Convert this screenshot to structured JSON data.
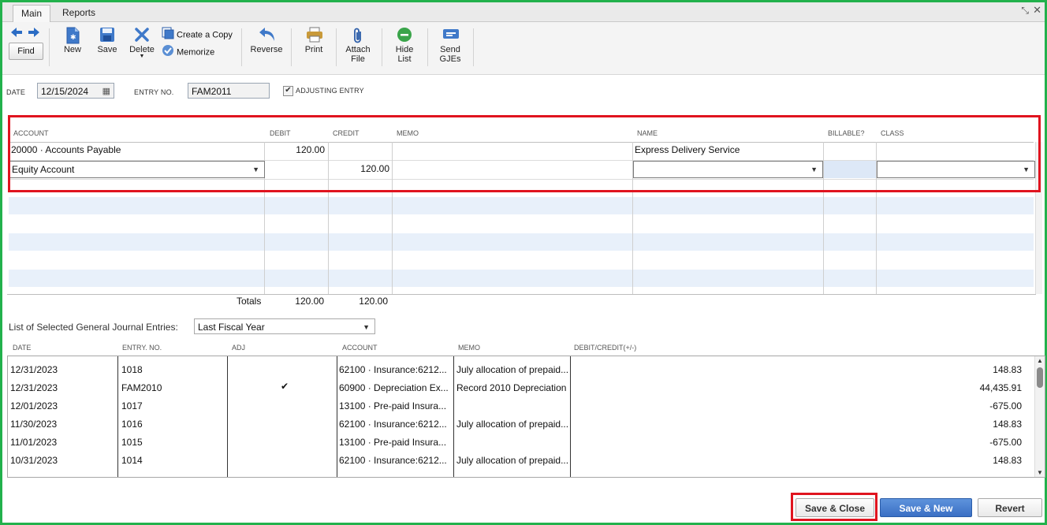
{
  "tabs": [
    {
      "label": "Main",
      "active": true
    },
    {
      "label": "Reports",
      "active": false
    }
  ],
  "toolbar": {
    "find": "Find",
    "new": "New",
    "save": "Save",
    "delete": "Delete",
    "create_copy": "Create a Copy",
    "memorize": "Memorize",
    "reverse": "Reverse",
    "print": "Print",
    "attach_line1": "Attach",
    "attach_line2": "File",
    "hide_line1": "Hide",
    "hide_line2": "List",
    "send_line1": "Send",
    "send_line2": "GJEs"
  },
  "header": {
    "date_label": "DATE",
    "date_value": "12/15/2024",
    "entry_label": "ENTRY NO.",
    "entry_value": "FAM2011",
    "adjusting_label": "ADJUSTING ENTRY",
    "adjusting_checked": true
  },
  "grid": {
    "columns": [
      "ACCOUNT",
      "DEBIT",
      "CREDIT",
      "MEMO",
      "NAME",
      "BILLABLE?",
      "CLASS"
    ],
    "rows": [
      {
        "account": "20000 · Accounts Payable",
        "debit": "120.00",
        "credit": "",
        "memo": "",
        "name": "Express Delivery Service",
        "billable": "",
        "class": ""
      },
      {
        "account": "Equity Account",
        "debit": "",
        "credit": "120.00",
        "memo": "",
        "name": "",
        "billable": "",
        "class": ""
      }
    ],
    "totals_label": "Totals",
    "total_debit": "120.00",
    "total_credit": "120.00"
  },
  "list": {
    "label": "List of Selected General Journal Entries:",
    "filter_value": "Last Fiscal Year",
    "columns": [
      "DATE",
      "ENTRY. NO.",
      "ADJ",
      "ACCOUNT",
      "MEMO",
      "DEBIT/CREDIT(+/-)"
    ],
    "rows": [
      {
        "date": "12/31/2023",
        "entry": "1018",
        "adj": "",
        "account": "62100 · Insurance:6212...",
        "memo": "July allocation of prepaid...",
        "amount": "148.83"
      },
      {
        "date": "12/31/2023",
        "entry": "FAM2010",
        "adj": "✔",
        "account": "60900 · Depreciation Ex...",
        "memo": "Record 2010 Depreciation",
        "amount": "44,435.91"
      },
      {
        "date": "12/01/2023",
        "entry": "1017",
        "adj": "",
        "account": "13100 · Pre-paid Insura...",
        "memo": "",
        "amount": "-675.00"
      },
      {
        "date": "11/30/2023",
        "entry": "1016",
        "adj": "",
        "account": "62100 · Insurance:6212...",
        "memo": "July allocation of prepaid...",
        "amount": "148.83"
      },
      {
        "date": "11/01/2023",
        "entry": "1015",
        "adj": "",
        "account": "13100 · Pre-paid Insura...",
        "memo": "",
        "amount": "-675.00"
      },
      {
        "date": "10/31/2023",
        "entry": "1014",
        "adj": "",
        "account": "62100 · Insurance:6212...",
        "memo": "July allocation of prepaid...",
        "amount": "148.83"
      }
    ]
  },
  "buttons": {
    "save_close": "Save & Close",
    "save_new": "Save & New",
    "revert": "Revert"
  },
  "colors": {
    "frame_border": "#22b14c",
    "highlight_box": "#e0141f",
    "primary_button": "#3a6fc4"
  }
}
